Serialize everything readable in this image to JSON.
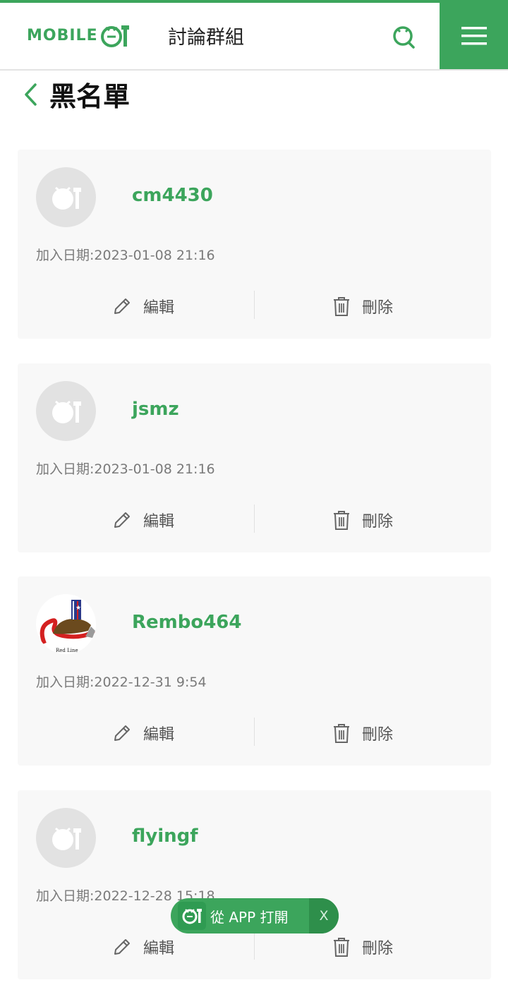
{
  "header": {
    "logo_text": "MOBILE",
    "site_title": "討論群組"
  },
  "page": {
    "title": "黑名單"
  },
  "colors": {
    "brand_green": "#3ca55c",
    "card_bg": "#f8f8f8",
    "date_text": "#7a7a7a"
  },
  "icons": [
    "search-icon",
    "menu-icon",
    "back-icon",
    "edit-icon",
    "trash-icon",
    "default-avatar-icon",
    "app-icon"
  ],
  "entries": [
    {
      "username": "cm4430",
      "date": "加入日期:2023-01-08 21:16",
      "edit_label": "編輯",
      "delete_label": "刪除"
    },
    {
      "username": "jsmz",
      "date": "加入日期:2023-01-08 21:16",
      "edit_label": "編輯",
      "delete_label": "刪除"
    },
    {
      "username": "Rembo464",
      "date": "加入日期:2022-12-31 9:54",
      "edit_label": "編輯",
      "delete_label": "刪除"
    },
    {
      "username": "flyingf",
      "date": "加入日期:2022-12-28 15:18",
      "edit_label": "編輯",
      "delete_label": "刪除"
    }
  ],
  "app_banner": {
    "label": "從 APP 打開",
    "close": "X"
  }
}
